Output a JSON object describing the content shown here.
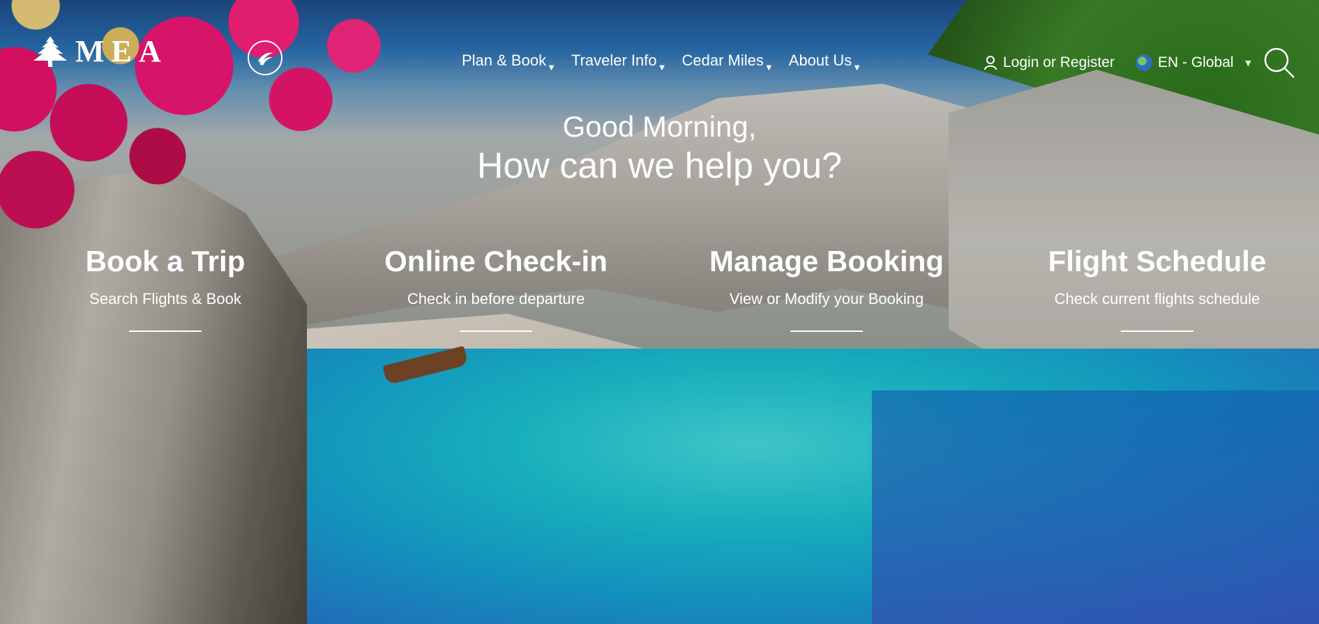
{
  "header": {
    "logo_text": "MEA",
    "nav": [
      {
        "label": "Plan & Book"
      },
      {
        "label": "Traveler Info"
      },
      {
        "label": "Cedar Miles"
      },
      {
        "label": "About Us"
      }
    ],
    "login_label": "Login or Register",
    "language_label": "EN - Global"
  },
  "hero": {
    "greeting": "Good Morning,",
    "headline": "How can we help you?"
  },
  "quick_links": [
    {
      "title": "Book a Trip",
      "subtitle": "Search Flights & Book"
    },
    {
      "title": "Online Check-in",
      "subtitle": "Check in before departure"
    },
    {
      "title": "Manage Booking",
      "subtitle": "View or Modify your Booking"
    },
    {
      "title": "Flight Schedule",
      "subtitle": "Check current flights schedule"
    }
  ],
  "icons": {
    "logo": "cedar-tree-icon",
    "alliance": "skyteam-icon",
    "user": "user-icon",
    "globe": "globe-icon",
    "search": "search-icon",
    "caret": "caret-down-icon"
  },
  "colors": {
    "text": "#ffffff",
    "flowers": "#e51c74",
    "sea": "#1cc8d6"
  }
}
